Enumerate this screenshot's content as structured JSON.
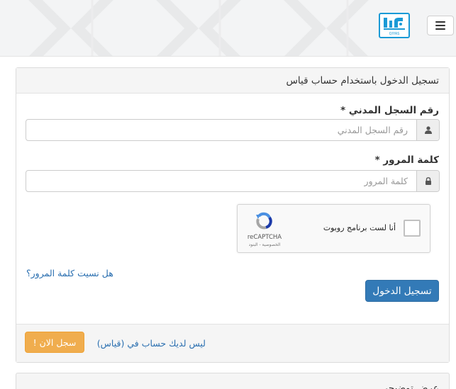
{
  "header": {
    "logo_text": "QIYAS"
  },
  "login_panel": {
    "title": "تسجيل الدخول باستخدام حساب قياس",
    "civil_id": {
      "label": "رقم السجل المدني *",
      "placeholder": "رقم السجل المدني",
      "value": ""
    },
    "password": {
      "label": "كلمة المرور *",
      "placeholder": "كلمة المرور",
      "value": ""
    },
    "captcha": {
      "checkbox_label": "أنا لست برنامج روبوت",
      "brand": "reCAPTCHA",
      "links": "الخصوصية - البنود"
    },
    "forgot_password": "هل نسيت كلمة المرور؟",
    "login_button": "تسجيل الدخول"
  },
  "footer": {
    "no_account_text": "ليس لديك حساب في (قياس)",
    "register_button": "سجل الان !"
  },
  "demo_panel": {
    "title": "عرض توضيحي"
  },
  "colors": {
    "primary": "#337ab7",
    "warning": "#f0ad4e",
    "link": "#2a6fb0",
    "logo": "#1a9ad6"
  }
}
